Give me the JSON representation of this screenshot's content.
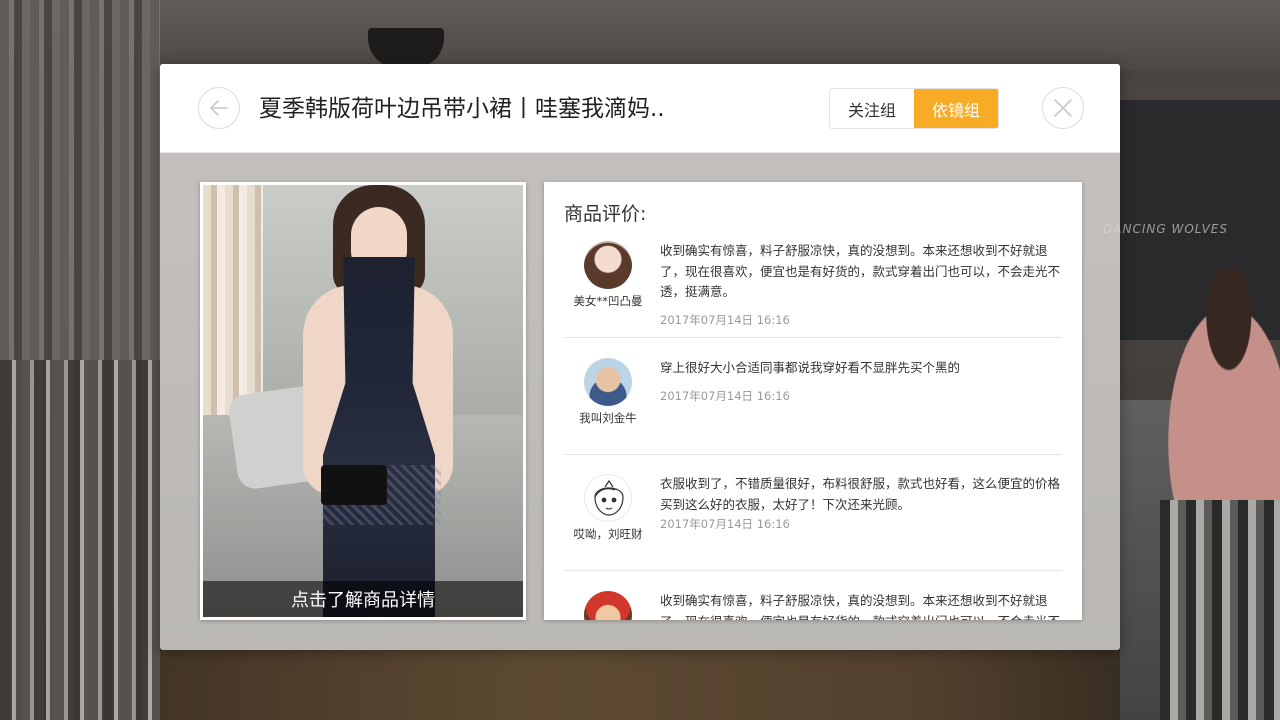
{
  "header": {
    "title": "夏季韩版荷叶边吊带小裙丨哇塞我滴妈..",
    "tabs": [
      {
        "label": "关注组",
        "active": false
      },
      {
        "label": "依镜组",
        "active": true
      }
    ],
    "back_icon": "arrow-left-icon",
    "close_icon": "close-icon"
  },
  "product": {
    "caption": "点击了解商品详情"
  },
  "reviews": {
    "title": "商品评价:",
    "items": [
      {
        "nickname": "美女**凹凸曼",
        "text": "收到确实有惊喜，料子舒服凉快，真的没想到。本来还想收到不好就退了，现在很喜欢，便宜也是有好货的，款式穿着出门也可以，不会走光不透，挺满意。",
        "time": "2017年07月14日 16:16"
      },
      {
        "nickname": "我叫刘金牛",
        "text": "穿上很好大小合适同事都说我穿好看不显胖先买个黑的",
        "time": "2017年07月14日 16:16"
      },
      {
        "nickname": "哎呦，刘旺财",
        "text": "衣服收到了，不错质量很好，布料很舒服，款式也好看，这么便宜的价格买到这么好的衣服，太好了！下次还来光顾。",
        "time": "2017年07月14日 16:16"
      },
      {
        "nickname": "",
        "text": "收到确实有惊喜，料子舒服凉快，真的没想到。本来还想收到不好就退了，现在很喜欢，便宜也是有好货的，款式穿着出门也可以，不会走光不透，挺满意。",
        "time": ""
      }
    ]
  },
  "background": {
    "store_sign": "DANCING WOLVES"
  },
  "colors": {
    "accent": "#f8ac26",
    "text_primary": "#222222",
    "text_secondary": "#999999"
  }
}
